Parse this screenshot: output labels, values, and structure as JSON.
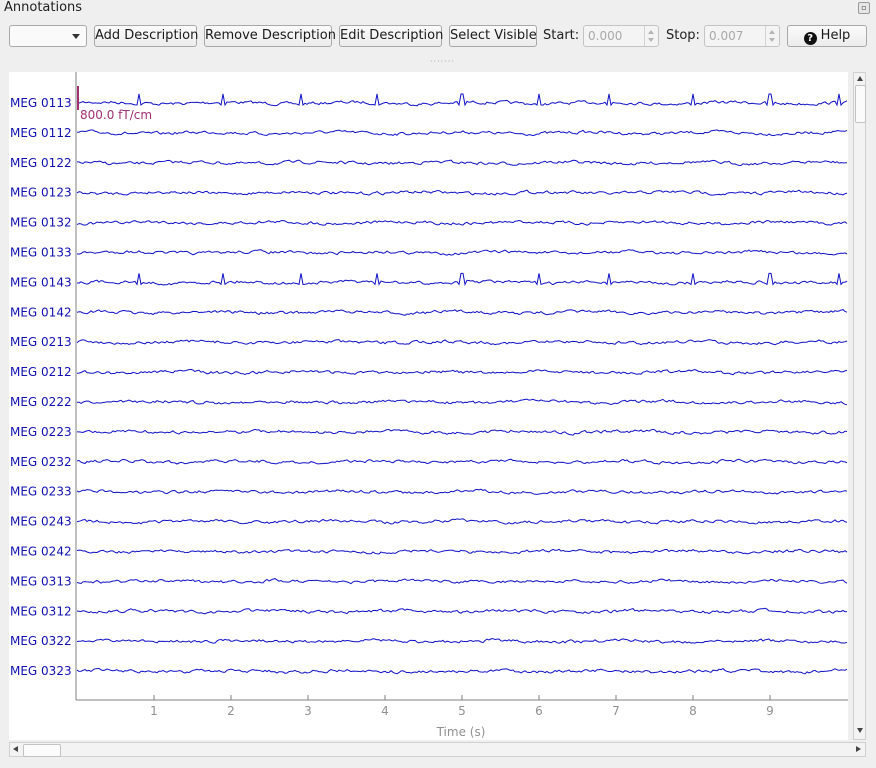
{
  "window": {
    "title": "Annotations"
  },
  "toolbar": {
    "combo_value": "",
    "add_label": "Add Description",
    "remove_label": "Remove Description",
    "edit_label": "Edit Description",
    "select_visible_label": "Select Visible",
    "start_label": "Start:",
    "start_value": "0.000",
    "stop_label": "Stop:",
    "stop_value": "0.007",
    "help_label": "Help"
  },
  "plot": {
    "channels": [
      "MEG 0113",
      "MEG 0112",
      "MEG 0122",
      "MEG 0123",
      "MEG 0132",
      "MEG 0133",
      "MEG 0143",
      "MEG 0142",
      "MEG 0213",
      "MEG 0212",
      "MEG 0222",
      "MEG 0223",
      "MEG 0232",
      "MEG 0233",
      "MEG 0243",
      "MEG 0242",
      "MEG 0313",
      "MEG 0312",
      "MEG 0322",
      "MEG 0323"
    ],
    "channels_with_spikes": [
      "MEG 0113",
      "MEG 0143"
    ],
    "spike_times_s": [
      0.8,
      1.9,
      2.9,
      3.9,
      5.0,
      6.0,
      6.9,
      8.0,
      9.0,
      9.9
    ],
    "scale_bar_label": "800.0 fT/cm",
    "xlabel": "Time (s)",
    "xticks": [
      "1",
      "2",
      "3",
      "4",
      "5",
      "6",
      "7",
      "8",
      "9"
    ],
    "xlim": [
      0,
      10
    ],
    "colors": {
      "trace": "#1010c8",
      "channel_label": "#1010b0",
      "scale_bar": "#a03070",
      "axis": "#808080"
    }
  }
}
